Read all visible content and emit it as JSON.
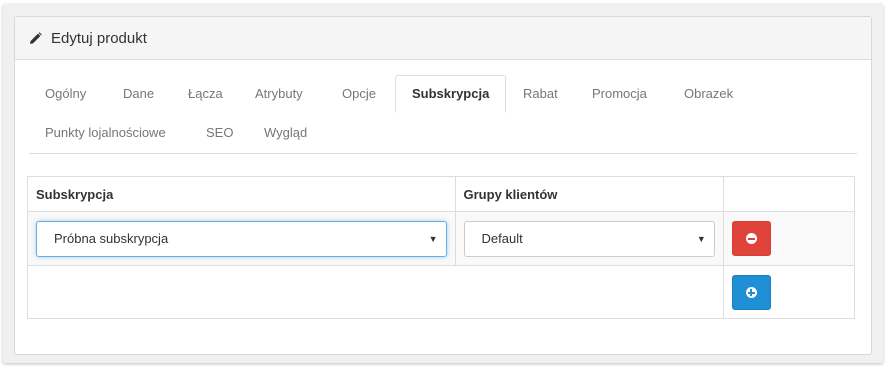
{
  "panel": {
    "title": "Edytuj produkt",
    "icon": "pencil-icon"
  },
  "tabs": [
    {
      "label": "Ogólny"
    },
    {
      "label": "Dane"
    },
    {
      "label": "Łącza"
    },
    {
      "label": "Atrybuty"
    },
    {
      "label": "Opcje"
    },
    {
      "label": "Subskrypcja",
      "active": true
    },
    {
      "label": "Rabat"
    },
    {
      "label": "Promocja"
    },
    {
      "label": "Obrazek"
    },
    {
      "label": "Punkty lojalnościowe"
    },
    {
      "label": "SEO"
    },
    {
      "label": "Wygląd"
    }
  ],
  "table": {
    "headers": [
      "Subskrypcja",
      "Grupy klientów",
      ""
    ],
    "rows": [
      {
        "subscription": "Próbna subskrypcja",
        "customer_group": "Default"
      }
    ]
  },
  "colors": {
    "remove": "#e0433a",
    "add": "#1f8fd6"
  }
}
